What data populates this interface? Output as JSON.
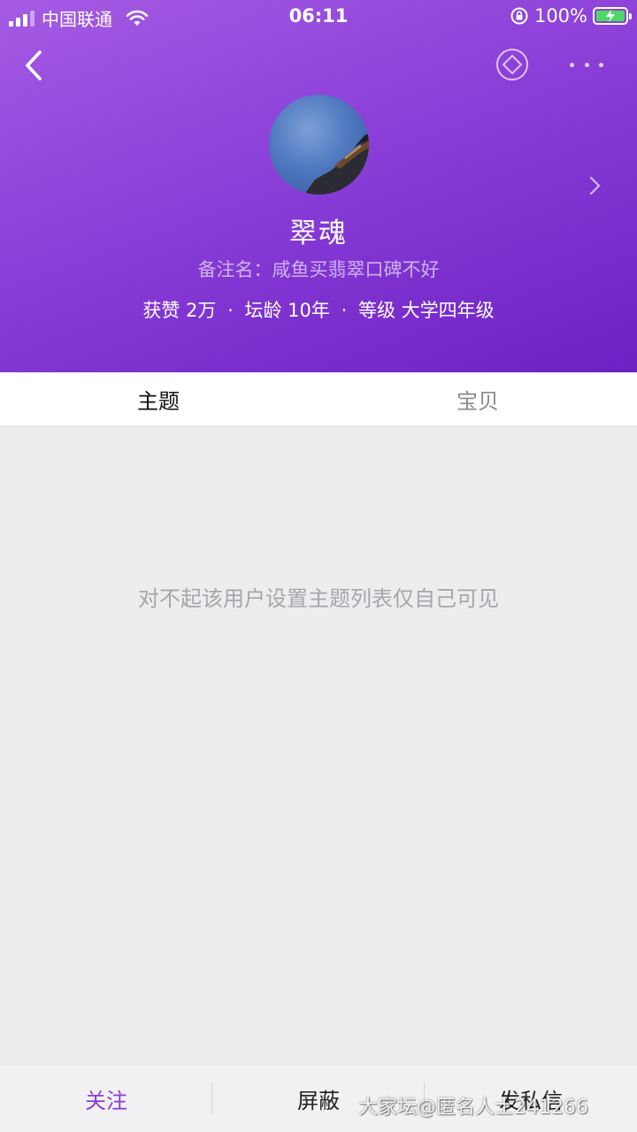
{
  "status_bar": {
    "carrier": "中国联通",
    "time": "06:11",
    "battery": "100%"
  },
  "profile": {
    "name": "翠魂",
    "remark": "备注名：咸鱼买翡翠口碑不好",
    "likes_label": "获赞",
    "likes_value": "2万",
    "age_label": "坛龄",
    "age_value": "10年",
    "level_label": "等级",
    "level_value": "大学四年级",
    "separator": "·"
  },
  "tabs": [
    {
      "label": "主题",
      "active": true
    },
    {
      "label": "宝贝",
      "active": false
    }
  ],
  "empty_message": "对不起该用户设置主题列表仅自己可见",
  "bottom_bar": {
    "follow": "关注",
    "block": "屏蔽",
    "message": "发私信"
  },
  "watermark": "大家坛@匿名人士241266",
  "colors": {
    "header_start": "#a55be3",
    "header_end": "#6c21c4",
    "accent": "#8e3ccf",
    "battery": "#4cd964"
  },
  "icons": [
    "back-arrow-icon",
    "diamond-badge-icon",
    "more-dots-icon",
    "chevron-right-icon",
    "wifi-icon",
    "rotation-lock-icon",
    "battery-icon"
  ]
}
